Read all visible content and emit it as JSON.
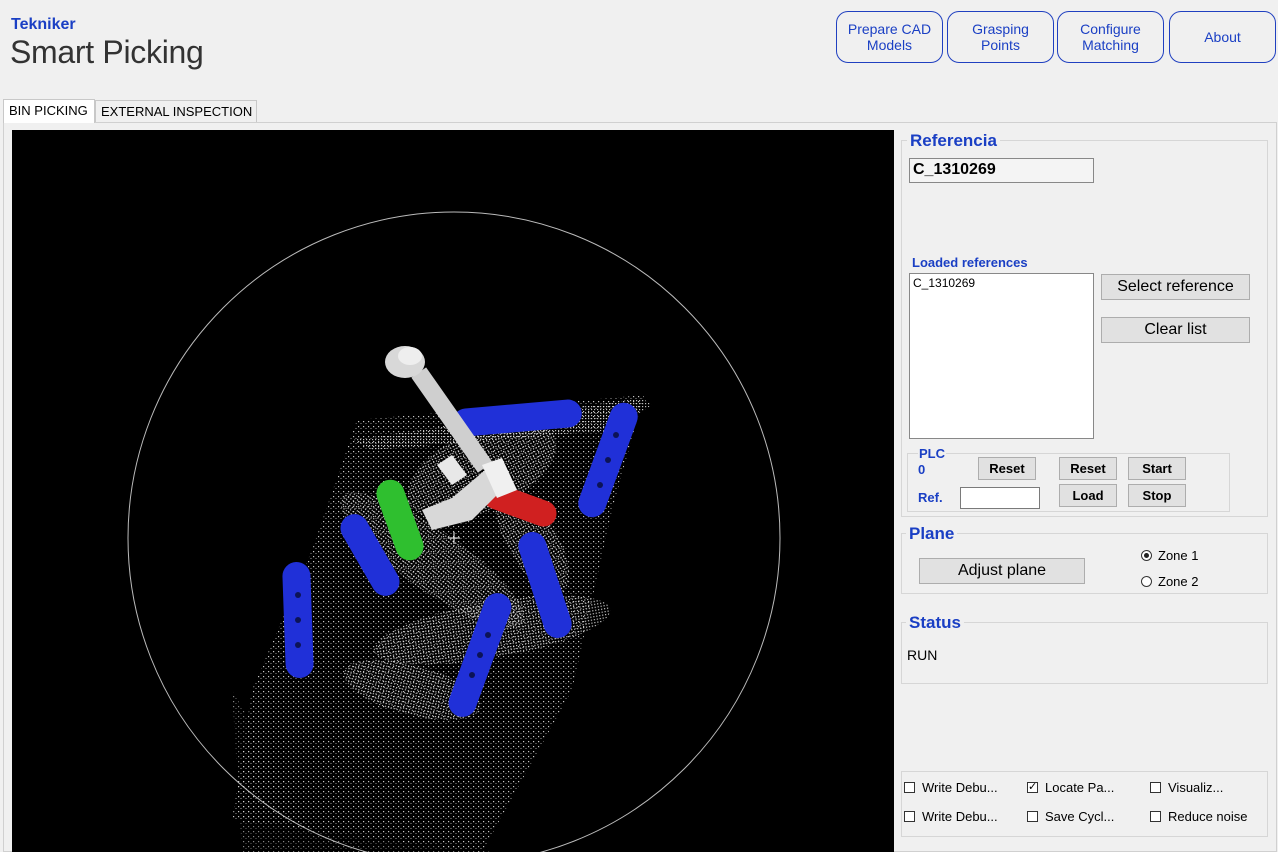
{
  "brand": {
    "company": "Tekniker",
    "product": "Smart Picking"
  },
  "top_buttons": [
    {
      "label": "Prepare CAD\nModels"
    },
    {
      "label": "Grasping\nPoints"
    },
    {
      "label": "Configure\nMatching"
    },
    {
      "label": "About"
    }
  ],
  "tabs": [
    {
      "label": "BIN PICKING",
      "active": true
    },
    {
      "label": "EXTERNAL INSPECTION",
      "active": false
    }
  ],
  "referencia": {
    "title": "Referencia",
    "value": "C_1310269",
    "loaded_title": "Loaded references",
    "loaded_items": [
      "C_1310269"
    ],
    "select_label": "Select reference",
    "clear_label": "Clear list"
  },
  "plc": {
    "title": "PLC",
    "value": "0",
    "reset_left": "Reset",
    "reset_right": "Reset",
    "start": "Start",
    "ref_label": "Ref.",
    "ref_value": "",
    "load": "Load",
    "stop": "Stop"
  },
  "plane": {
    "title": "Plane",
    "adjust_label": "Adjust plane",
    "zones": [
      {
        "label": "Zone 1",
        "checked": true
      },
      {
        "label": "Zone 2",
        "checked": false
      }
    ]
  },
  "status": {
    "title": "Status",
    "value": "RUN"
  },
  "options": [
    {
      "label": "Write Debu...",
      "checked": false
    },
    {
      "label": "Locate Pa...",
      "checked": true
    },
    {
      "label": "Visualiz...",
      "checked": false
    },
    {
      "label": "Write Debu...",
      "checked": false
    },
    {
      "label": "Save Cycl...",
      "checked": false
    },
    {
      "label": "Reduce noise",
      "checked": false
    }
  ],
  "colors": {
    "accent": "#1a3fc4",
    "green_part": "#2fbf2f",
    "red_part": "#d02020",
    "blue_part": "#2030d8"
  }
}
